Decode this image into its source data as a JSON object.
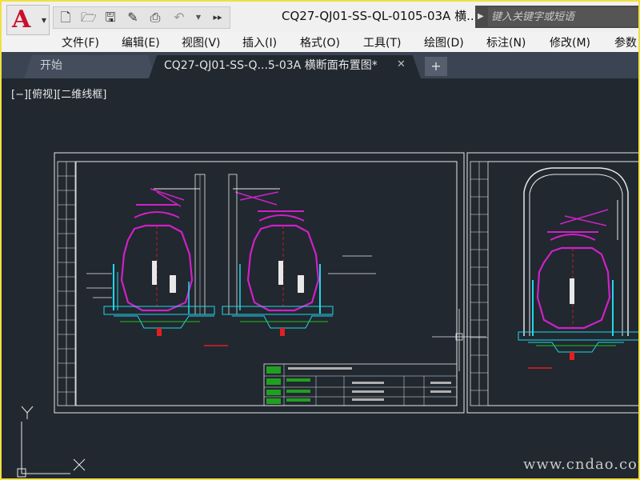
{
  "title_bar": {
    "document_title": "CQ27-QJ01-SS-QL-0105-03A 横...",
    "search_placeholder": "键入关键字或短语"
  },
  "quick_access": {
    "icons": [
      "new-file-icon",
      "open-icon",
      "save-icon",
      "save-as-icon",
      "plot-icon",
      "undo-icon",
      "dropdown-icon",
      "more-icon"
    ]
  },
  "menu": {
    "items": [
      "文件(F)",
      "编辑(E)",
      "视图(V)",
      "插入(I)",
      "格式(O)",
      "工具(T)",
      "绘图(D)",
      "标注(N)",
      "修改(M)",
      "参数"
    ]
  },
  "tabs": {
    "start_label": "开始",
    "doc_label": "CQ27-QJ01-SS-Q...5-03A 横断面布置图*",
    "close_glyph": "✕",
    "add_glyph": "+"
  },
  "viewport": {
    "label": "[−][俯视][二维线框]"
  },
  "ucs": {
    "y_label": "Y",
    "x_label": "X"
  },
  "watermark": "www.cndao.com",
  "colors": {
    "canvas": "#212830",
    "magenta": "#d020c8",
    "cyan": "#20d8e8",
    "green": "#20c020",
    "red": "#e02020",
    "white": "#e8e8e8"
  }
}
